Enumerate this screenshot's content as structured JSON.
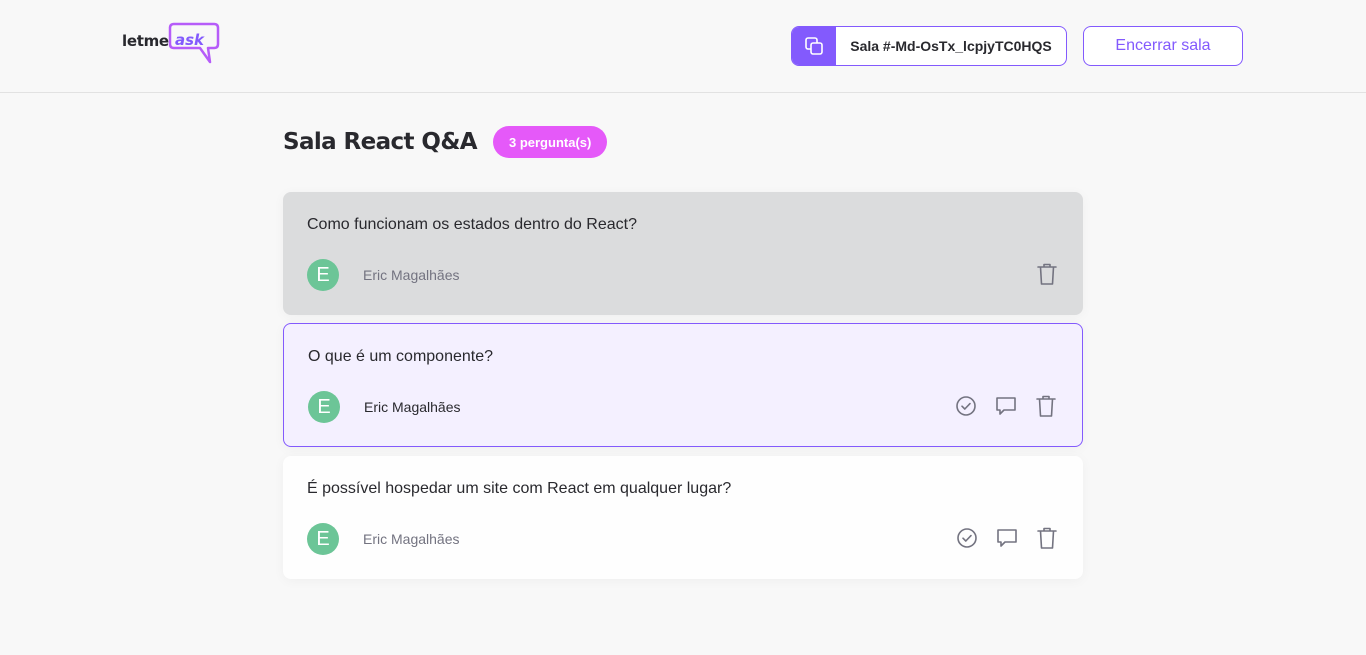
{
  "header": {
    "logo_text_1": "letme",
    "logo_text_2": "ask",
    "room_code": "Sala #-Md-OsTx_lcpjyTC0HQS",
    "close_room_label": "Encerrar sala"
  },
  "room": {
    "title": "Sala React Q&A",
    "question_count": "3 pergunta(s)"
  },
  "questions": [
    {
      "text": "Como funcionam os estados dentro do React?",
      "author": "Eric Magalhães",
      "avatar_initial": "E",
      "state": "answered"
    },
    {
      "text": "O que é um componente?",
      "author": "Eric Magalhães",
      "avatar_initial": "E",
      "state": "highlighted"
    },
    {
      "text": "É possível hospedar um site com React em qualquer lugar?",
      "author": "Eric Magalhães",
      "avatar_initial": "E",
      "state": "default"
    }
  ],
  "colors": {
    "accent": "#835afd",
    "badge": "#e559f9",
    "avatar": "#6cc597",
    "answered_bg": "#dbdcdd",
    "highlighted_bg": "#f4f0ff"
  },
  "icons": [
    "copy-icon",
    "check-circle-icon",
    "answer-icon",
    "trash-icon"
  ]
}
